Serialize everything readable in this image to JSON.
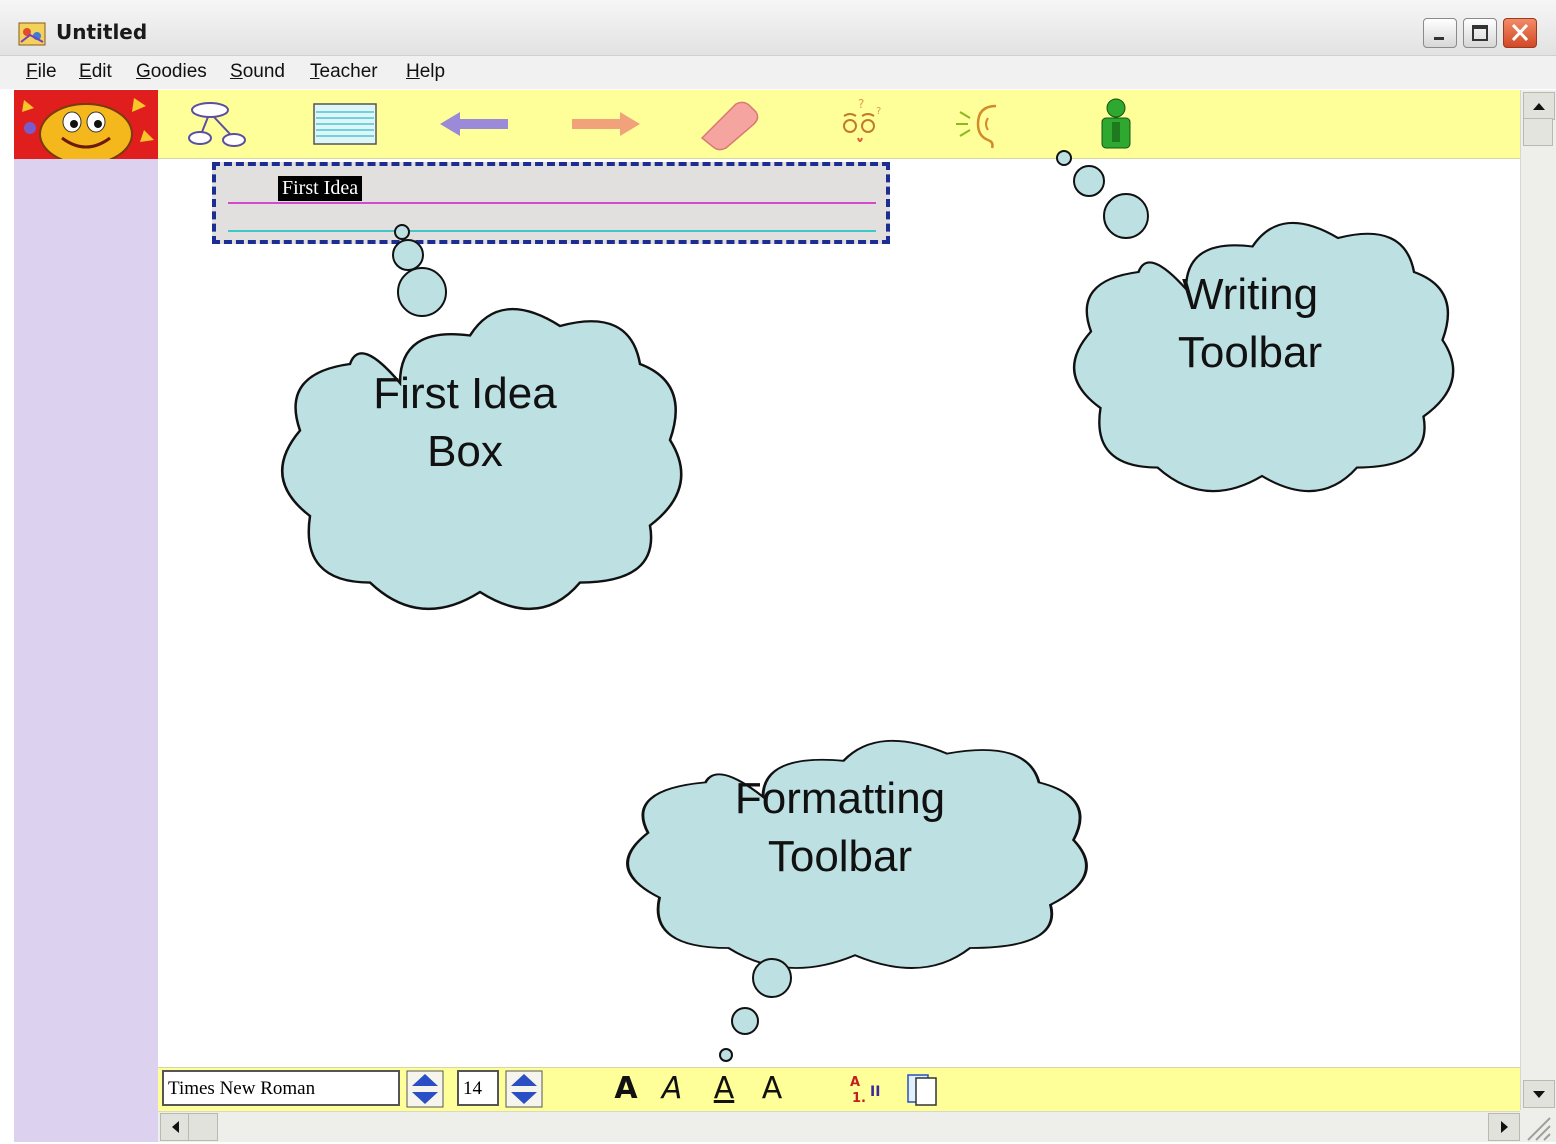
{
  "window": {
    "title": "Untitled"
  },
  "menu": {
    "items": [
      "File",
      "Edit",
      "Goodies",
      "Sound",
      "Teacher",
      "Help"
    ]
  },
  "writing_toolbar": {
    "tools": [
      "idea-map-icon",
      "lined-paper-icon",
      "back-arrow-icon",
      "forward-arrow-icon",
      "eraser-icon",
      "thinking-face-icon",
      "ear-icon",
      "teacher-person-icon"
    ]
  },
  "idea_box": {
    "text": "First Idea"
  },
  "callouts": {
    "first_idea_line1": "First Idea",
    "first_idea_line2": "Box",
    "writing_line1": "Writing",
    "writing_line2": "Toolbar",
    "formatting_line1": "Formatting",
    "formatting_line2": "Toolbar"
  },
  "formatting_toolbar": {
    "font_name": "Times New Roman",
    "font_size": "14",
    "bold_label": "A",
    "italic_label": "A",
    "underline_label": "A",
    "color_label": "A"
  },
  "colors": {
    "toolbar_yellow": "#ffff99",
    "left_panel": "#dcd1ef",
    "cloud_fill": "#bde0e3",
    "idea_border": "#1d2d92"
  }
}
